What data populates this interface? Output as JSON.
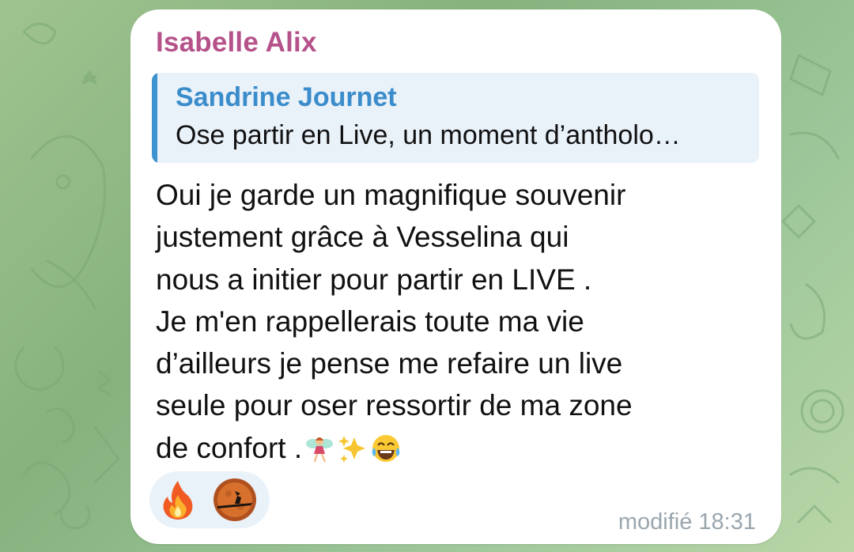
{
  "chat": {
    "message": {
      "sender": "Isabelle Alix",
      "reply": {
        "name": "Sandrine Journet",
        "text": "Ose partir en Live, un moment d’antholo…"
      },
      "lines": [
        "Oui je garde un magnifique souvenir",
        "justement grâce à Vesselina qui",
        "nous a initier pour partir en LIVE .",
        "Je m'en rappellerais toute ma vie",
        "d’ailleurs je pense me refaire un live",
        "seule pour oser ressortir de ma zone",
        "de confort ."
      ],
      "trailing_emojis": [
        "fairy-emoji",
        "sparkles-emoji",
        "tears-of-joy-emoji"
      ],
      "reactions": [
        {
          "icon": "fire-icon"
        },
        {
          "icon": "moon-witch-icon"
        }
      ],
      "status": "modifié 18:31"
    },
    "colors": {
      "sender": "#b5528a",
      "reply_accent": "#3e92cf",
      "reply_background": "#e9f1f9",
      "meta": "#9aa6ae"
    }
  }
}
